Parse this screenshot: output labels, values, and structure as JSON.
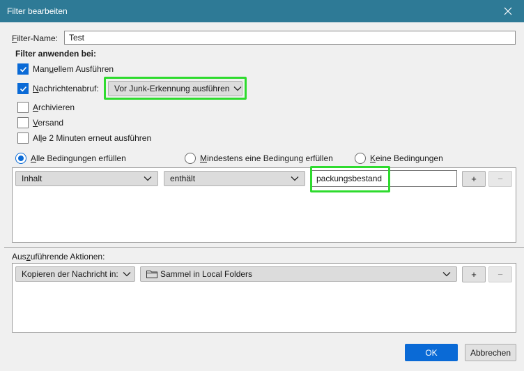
{
  "window": {
    "title": "Filter bearbeiten"
  },
  "filter_name": {
    "label_prefix": "F",
    "label_rest": "ilter-Name:",
    "value": "Test"
  },
  "apply_section": {
    "heading": "Filter anwenden bei:",
    "manual": {
      "pre": "Man",
      "key": "u",
      "post": "ellem Ausführen",
      "checked": true
    },
    "fetch": {
      "key": "N",
      "post": "achrichtenabruf:",
      "checked": true,
      "dropdown_value": "Vor Junk-Erkennung ausführen"
    },
    "archive": {
      "key": "A",
      "post": "rchivieren",
      "checked": false
    },
    "send": {
      "key": "V",
      "post": "ersand",
      "checked": false
    },
    "periodic": {
      "pre": "Al",
      "key": "l",
      "post": "e 2 Minuten erneut ausführen",
      "checked": false
    }
  },
  "match_options": {
    "all": {
      "key": "A",
      "post": "lle Bedingungen erfüllen",
      "selected": true
    },
    "any": {
      "key": "M",
      "post": "indestens eine Bedingung erfüllen",
      "selected": false
    },
    "none": {
      "key": "K",
      "post": "eine Bedingungen",
      "selected": false
    }
  },
  "condition": {
    "field": "Inhalt",
    "operator": "enthält",
    "value": "packungsbestand",
    "add_label": "+",
    "remove_label": "−"
  },
  "actions": {
    "label_pre": "Aus",
    "label_key": "z",
    "label_post": "uführende Aktionen:",
    "action_type": "Kopieren der Nachricht in:",
    "target_folder": "Sammel in Local Folders",
    "add_label": "+",
    "remove_label": "−"
  },
  "footer": {
    "ok_label": "OK",
    "cancel_label": "Abbrechen"
  },
  "colors": {
    "titlebar": "#2e7a96",
    "accent": "#0a6ad6",
    "highlight": "#2edb2e"
  }
}
